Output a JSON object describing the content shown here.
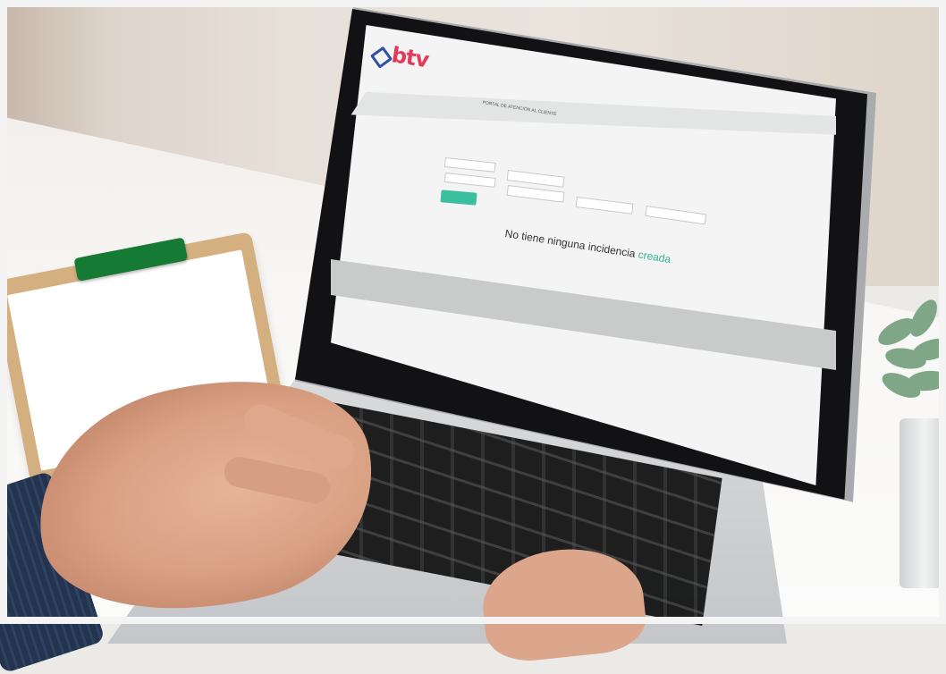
{
  "scene": {
    "description_colors": {
      "wall": "#e7e0d9",
      "desk": "#f8f7f5",
      "laptop_body": "#c4c6c9",
      "screen_bg": "#f4f4f4",
      "accent": "#3bbf9f",
      "logo_red": "#e23a5a",
      "logo_blue": "#2d4fa8"
    }
  },
  "screen": {
    "logo_text": "btv",
    "page_title": "PORTAL DE ATENCIÓN AL CLIENTE",
    "message_main": "No tiene ninguna incidencia",
    "message_accent": "creada"
  }
}
